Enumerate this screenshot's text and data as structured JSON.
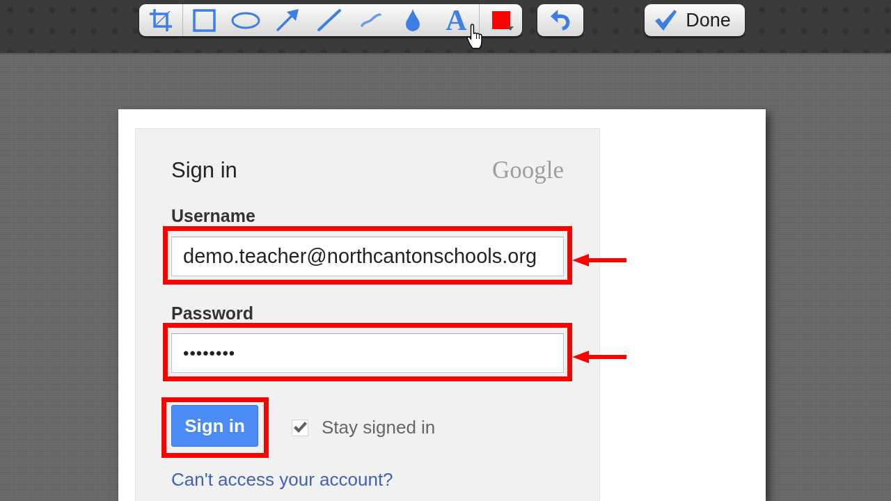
{
  "toolbar": {
    "tools": [
      {
        "kind": "crop",
        "hovered": false
      },
      {
        "kind": "rectangle",
        "hovered": false
      },
      {
        "kind": "ellipse",
        "hovered": false
      },
      {
        "kind": "arrow",
        "hovered": false
      },
      {
        "kind": "line",
        "hovered": false
      },
      {
        "kind": "freehand",
        "hovered": false
      },
      {
        "kind": "drop",
        "hovered": false
      },
      {
        "kind": "text",
        "glyph": "A",
        "hovered": true
      },
      {
        "kind": "color",
        "color": "#ff0000",
        "hovered": false
      }
    ],
    "buttons": [
      {
        "kind": "undo"
      },
      {
        "kind": "done",
        "label": "Done"
      }
    ]
  },
  "sign_in_form": {
    "title": "Sign in",
    "logo": "Google",
    "fields": [
      {
        "kind": "text",
        "label": "Username",
        "value": "demo.teacher@northcantonschools.org",
        "highlighted": true,
        "arrow": true
      },
      {
        "kind": "password",
        "label": "Password",
        "value": "••••••••",
        "highlighted": true,
        "arrow": true
      }
    ],
    "submit_button": {
      "label": "Sign in",
      "highlighted": true
    },
    "stay_signed_in": {
      "label": "Stay signed in",
      "checked": true
    },
    "help_link": "Can't access your account?"
  }
}
